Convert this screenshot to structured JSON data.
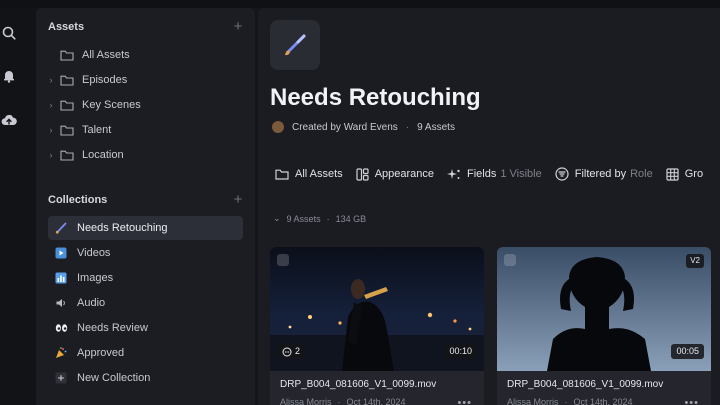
{
  "sidebar": {
    "assets_heading": "Assets",
    "asset_items": [
      {
        "label": "All Assets",
        "has_chevron": false
      },
      {
        "label": "Episodes",
        "has_chevron": true
      },
      {
        "label": "Key Scenes",
        "has_chevron": true
      },
      {
        "label": "Talent",
        "has_chevron": true
      },
      {
        "label": "Location",
        "has_chevron": true
      }
    ],
    "collections_heading": "Collections",
    "collection_items": [
      {
        "label": "Needs Retouching",
        "icon": "paintbrush-icon",
        "active": true
      },
      {
        "label": "Videos",
        "icon": "play-icon",
        "active": false
      },
      {
        "label": "Images",
        "icon": "image-icon",
        "active": false
      },
      {
        "label": "Audio",
        "icon": "speaker-icon",
        "active": false
      },
      {
        "label": "Needs Review",
        "icon": "eyes-icon",
        "active": false
      },
      {
        "label": "Approved",
        "icon": "party-popper-icon",
        "active": false
      },
      {
        "label": "New Collection",
        "icon": "plus-icon",
        "active": false
      }
    ]
  },
  "header": {
    "title": "Needs Retouching",
    "created_by": "Created by Ward Evens",
    "asset_count": "9 Assets"
  },
  "toolbar": {
    "all_assets": "All Assets",
    "appearance": "Appearance",
    "fields": "Fields",
    "fields_visible": "1 Visible",
    "filtered_by": "Filtered by",
    "filtered_value": "Role",
    "group": "Gro"
  },
  "summary": {
    "count": "9 Assets",
    "size": "134 GB"
  },
  "cards": [
    {
      "filename": "DRP_B004_081606_V1_0099.mov",
      "author": "Alissa Morris",
      "date": "Oct 14th, 2024",
      "duration": "00:10",
      "comments": "2",
      "version": ""
    },
    {
      "filename": "DRP_B004_081606_V1_0099.mov",
      "author": "Alissa Morris",
      "date": "Oct 14th, 2024",
      "duration": "00:05",
      "comments": "",
      "version": "V2"
    }
  ],
  "colors": {
    "sidebar_bg": "#1c1d23",
    "main_bg": "#1b1c22",
    "active_row": "#2d2f38",
    "text_primary": "#f1f2f6",
    "text_muted": "#7e808a"
  }
}
